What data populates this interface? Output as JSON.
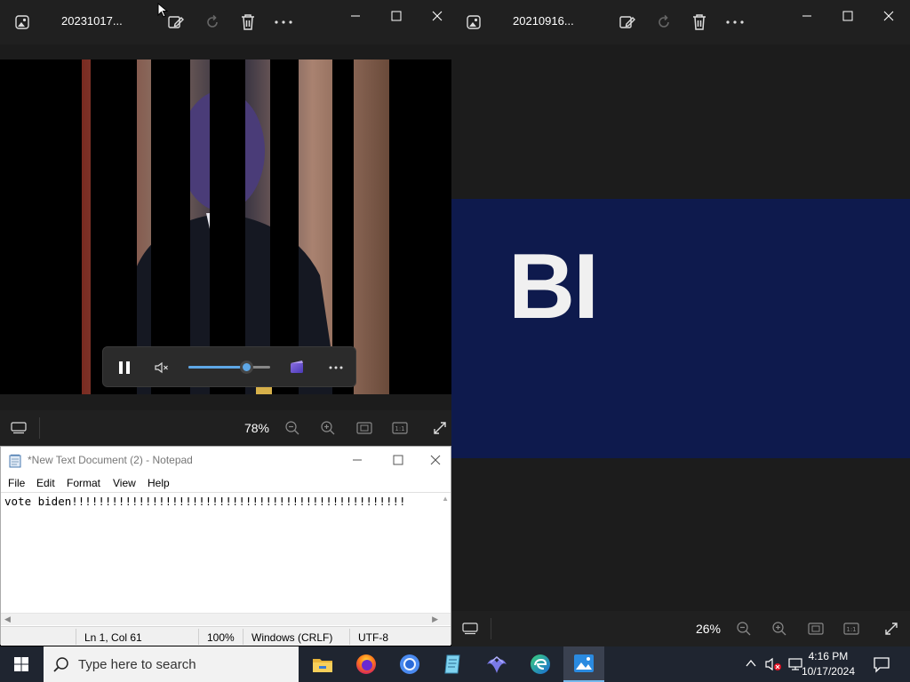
{
  "left_window": {
    "title": "20231017...",
    "zoom": "78%",
    "video_controls": {
      "volume_percent": 72
    }
  },
  "right_window": {
    "title": "20210916...",
    "zoom": "26%",
    "banner_text": "BI"
  },
  "notepad": {
    "title": "*New Text Document (2) - Notepad",
    "menu": [
      "File",
      "Edit",
      "Format",
      "View",
      "Help"
    ],
    "content": "vote biden!!!!!!!!!!!!!!!!!!!!!!!!!!!!!!!!!!!!!!!!!!!!!!!!!!",
    "status": {
      "position": "Ln 1, Col 61",
      "zoom": "100%",
      "line_ending": "Windows (CRLF)",
      "encoding": "UTF-8"
    }
  },
  "taskbar": {
    "search_placeholder": "Type here to search",
    "time": "4:16 PM",
    "date": "10/17/2024",
    "apps": [
      "file-explorer",
      "firefox",
      "chrome",
      "notepad",
      "media-app",
      "edge",
      "photos"
    ]
  },
  "colors": {
    "window_bg": "#202020",
    "banner_bg": "#0e1a4d",
    "taskbar_bg": "#1f2530",
    "accent": "#5ea7e6"
  }
}
